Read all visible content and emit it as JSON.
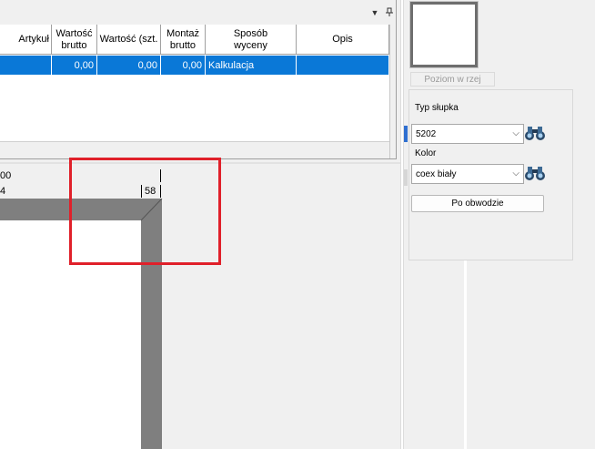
{
  "grid": {
    "columns": [
      {
        "label": "Artykuł"
      },
      {
        "label": "Wartość\nbrutto"
      },
      {
        "label": "Wartość (szt."
      },
      {
        "label": "Montaż\nbrutto"
      },
      {
        "label": "Sposób\nwyceny"
      },
      {
        "label": "Opis"
      }
    ],
    "rows": [
      {
        "artykul": "",
        "wartosc_brutto": "0,00",
        "wartosc_szt": "0,00",
        "montaz_brutto": "0,00",
        "sposob_wyceny": "Kalkulacja",
        "opis": ""
      }
    ]
  },
  "ruler": {
    "top_label": "00",
    "bottom_label": "4",
    "measure": "58"
  },
  "right_panel": {
    "level_button": "Poziom w  rzej",
    "post_type_label": "Typ słupka",
    "post_type_value": "5202",
    "color_label": "Kolor",
    "color_value": "coex biały",
    "perimeter_button": "Po obwodzie"
  },
  "colors": {
    "selection": "#0a78d7",
    "highlight": "#e0202a",
    "frame": "#7f7f7f"
  }
}
